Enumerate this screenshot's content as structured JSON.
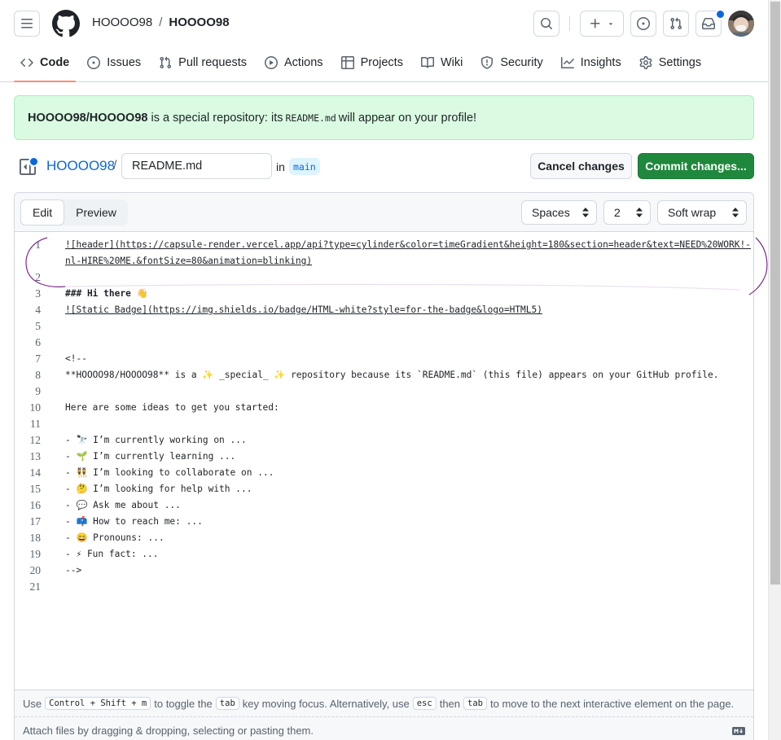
{
  "header": {
    "owner": "HOOOO98",
    "separator": "/",
    "repo": "HOOOO98"
  },
  "nav": [
    {
      "label": "Code",
      "icon": "code-icon",
      "active": true
    },
    {
      "label": "Issues",
      "icon": "issue-opened-icon",
      "active": false
    },
    {
      "label": "Pull requests",
      "icon": "git-pull-request-icon",
      "active": false
    },
    {
      "label": "Actions",
      "icon": "play-icon",
      "active": false
    },
    {
      "label": "Projects",
      "icon": "table-icon",
      "active": false
    },
    {
      "label": "Wiki",
      "icon": "book-icon",
      "active": false
    },
    {
      "label": "Security",
      "icon": "shield-icon",
      "active": false
    },
    {
      "label": "Insights",
      "icon": "graph-icon",
      "active": false
    },
    {
      "label": "Settings",
      "icon": "gear-icon",
      "active": false
    }
  ],
  "banner": {
    "repo_name": "HOOOO98/HOOOO98",
    "text_before": "is a special repository: its",
    "code": "README.md",
    "text_after": "will appear on your profile!"
  },
  "file_row": {
    "repo_link": "HOOOO98",
    "slash": "/",
    "filename": "README.md",
    "in_label": "in",
    "branch": "main",
    "cancel_label": "Cancel changes",
    "commit_label": "Commit changes..."
  },
  "editor": {
    "tab_edit": "Edit",
    "tab_preview": "Preview",
    "indent_mode": "Spaces",
    "indent_size": "2",
    "wrap_mode": "Soft wrap",
    "lines": [
      {
        "n": "1",
        "text": "![header](https://capsule-render.vercel.app/api?type=cylinder&color=timeGradient&height=180&section=header&text=NEED%20WORK!-",
        "style": "link"
      },
      {
        "n": "",
        "text": "nl-HIRE%20ME.&fontSize=80&animation=blinking)",
        "style": "link"
      },
      {
        "n": "2",
        "text": "",
        "style": ""
      },
      {
        "n": "3",
        "text": "### Hi there 👋",
        "style": "bold"
      },
      {
        "n": "4",
        "text": "![Static Badge](https://img.shields.io/badge/HTML-white?style=for-the-badge&logo=HTML5)",
        "style": "link"
      },
      {
        "n": "5",
        "text": "",
        "style": ""
      },
      {
        "n": "6",
        "text": "",
        "style": ""
      },
      {
        "n": "7",
        "text": "<!--",
        "style": ""
      },
      {
        "n": "8",
        "text": "**HOOOO98/HOOOO98** is a ✨ _special_ ✨ repository because its `README.md` (this file) appears on your GitHub profile.",
        "style": ""
      },
      {
        "n": "9",
        "text": "",
        "style": ""
      },
      {
        "n": "10",
        "text": "Here are some ideas to get you started:",
        "style": ""
      },
      {
        "n": "11",
        "text": "",
        "style": ""
      },
      {
        "n": "12",
        "text": "- 🔭 I’m currently working on ...",
        "style": ""
      },
      {
        "n": "13",
        "text": "- 🌱 I’m currently learning ...",
        "style": ""
      },
      {
        "n": "14",
        "text": "- 👯 I’m looking to collaborate on ...",
        "style": ""
      },
      {
        "n": "15",
        "text": "- 🤔 I’m looking for help with ...",
        "style": ""
      },
      {
        "n": "16",
        "text": "- 💬 Ask me about ...",
        "style": ""
      },
      {
        "n": "17",
        "text": "- 📫 How to reach me: ...",
        "style": ""
      },
      {
        "n": "18",
        "text": "- 😄 Pronouns: ...",
        "style": ""
      },
      {
        "n": "19",
        "text": "- ⚡ Fun fact: ...",
        "style": ""
      },
      {
        "n": "20",
        "text": "-->",
        "style": ""
      },
      {
        "n": "21",
        "text": "",
        "style": ""
      }
    ],
    "hint": {
      "use": "Use",
      "keys": "Control + Shift + m",
      "t1": "to toggle the",
      "tab_key": "tab",
      "t2": "key moving focus. Alternatively, use",
      "esc_key": "esc",
      "then": "then",
      "tab_key2": "tab",
      "t3": "to move to the next interactive element on the page."
    },
    "attach_text": "Attach files by dragging & dropping, selecting or pasting them."
  },
  "colors": {
    "accent": "#0969da",
    "commit_green": "#1f883d",
    "banner_bg": "#dafbe1",
    "nav_underline": "#fd8c73",
    "annotation": "#7b2d8e"
  }
}
